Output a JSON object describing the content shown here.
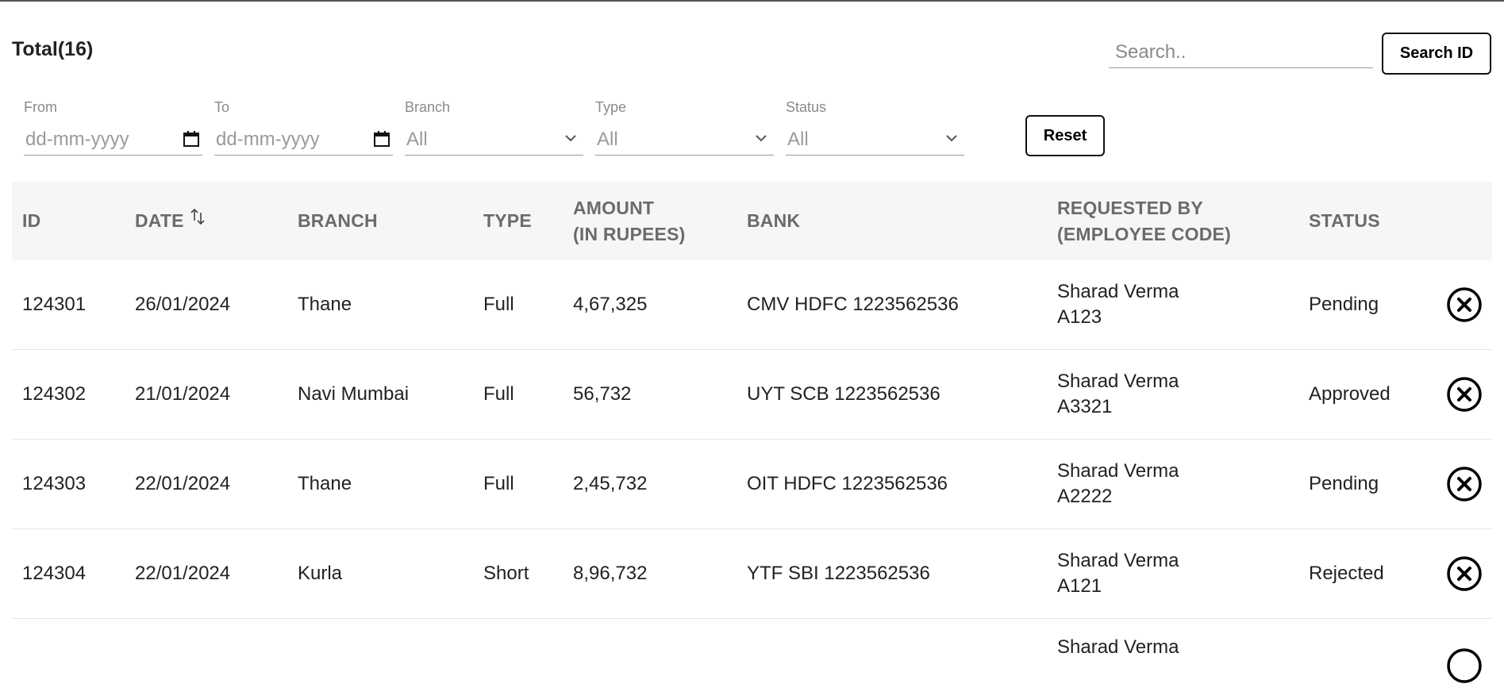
{
  "header": {
    "total_label": "Total(16)"
  },
  "search": {
    "placeholder": "Search..",
    "value": "",
    "button_label": "Search ID"
  },
  "filters": {
    "from": {
      "label": "From",
      "placeholder": "dd-mm-yyyy",
      "icon": "calendar-icon"
    },
    "to": {
      "label": "To",
      "placeholder": "dd-mm-yyyy",
      "icon": "calendar-icon"
    },
    "branch": {
      "label": "Branch",
      "value": "All",
      "icon": "chevron-down-icon"
    },
    "type": {
      "label": "Type",
      "value": "All",
      "icon": "chevron-down-icon"
    },
    "status": {
      "label": "Status",
      "value": "All",
      "icon": "chevron-down-icon"
    },
    "reset_label": "Reset"
  },
  "table": {
    "columns": {
      "id": "ID",
      "date": "DATE",
      "branch": "BRANCH",
      "type": "TYPE",
      "amount_line1": "AMOUNT",
      "amount_line2": "(IN RUPEES)",
      "bank": "BANK",
      "requested_line1": "REQUESTED BY",
      "requested_line2": "(EMPLOYEE CODE)",
      "status": "STATUS"
    },
    "rows": [
      {
        "id": "124301",
        "date": "26/01/2024",
        "branch": "Thane",
        "type": "Full",
        "amount": "4,67,325",
        "bank": "CMV HDFC 1223562536",
        "requester": "Sharad Verma",
        "code": "A123",
        "status": "Pending"
      },
      {
        "id": "124302",
        "date": "21/01/2024",
        "branch": "Navi Mumbai",
        "type": "Full",
        "amount": "56,732",
        "bank": "UYT SCB 1223562536",
        "requester": "Sharad Verma",
        "code": "A3321",
        "status": "Approved"
      },
      {
        "id": "124303",
        "date": "22/01/2024",
        "branch": "Thane",
        "type": "Full",
        "amount": "2,45,732",
        "bank": "OIT HDFC 1223562536",
        "requester": "Sharad Verma",
        "code": "A2222",
        "status": "Pending"
      },
      {
        "id": "124304",
        "date": "22/01/2024",
        "branch": "Kurla",
        "type": "Short",
        "amount": "8,96,732",
        "bank": "YTF SBI 1223562536",
        "requester": "Sharad Verma",
        "code": "A121",
        "status": "Rejected"
      }
    ],
    "partial_row": {
      "requester": "Sharad Verma"
    }
  },
  "colors": {
    "border_dark": "#111111",
    "header_bg": "#f6f6f6",
    "header_text": "#6b6b6b",
    "muted": "#8a8a8a"
  }
}
